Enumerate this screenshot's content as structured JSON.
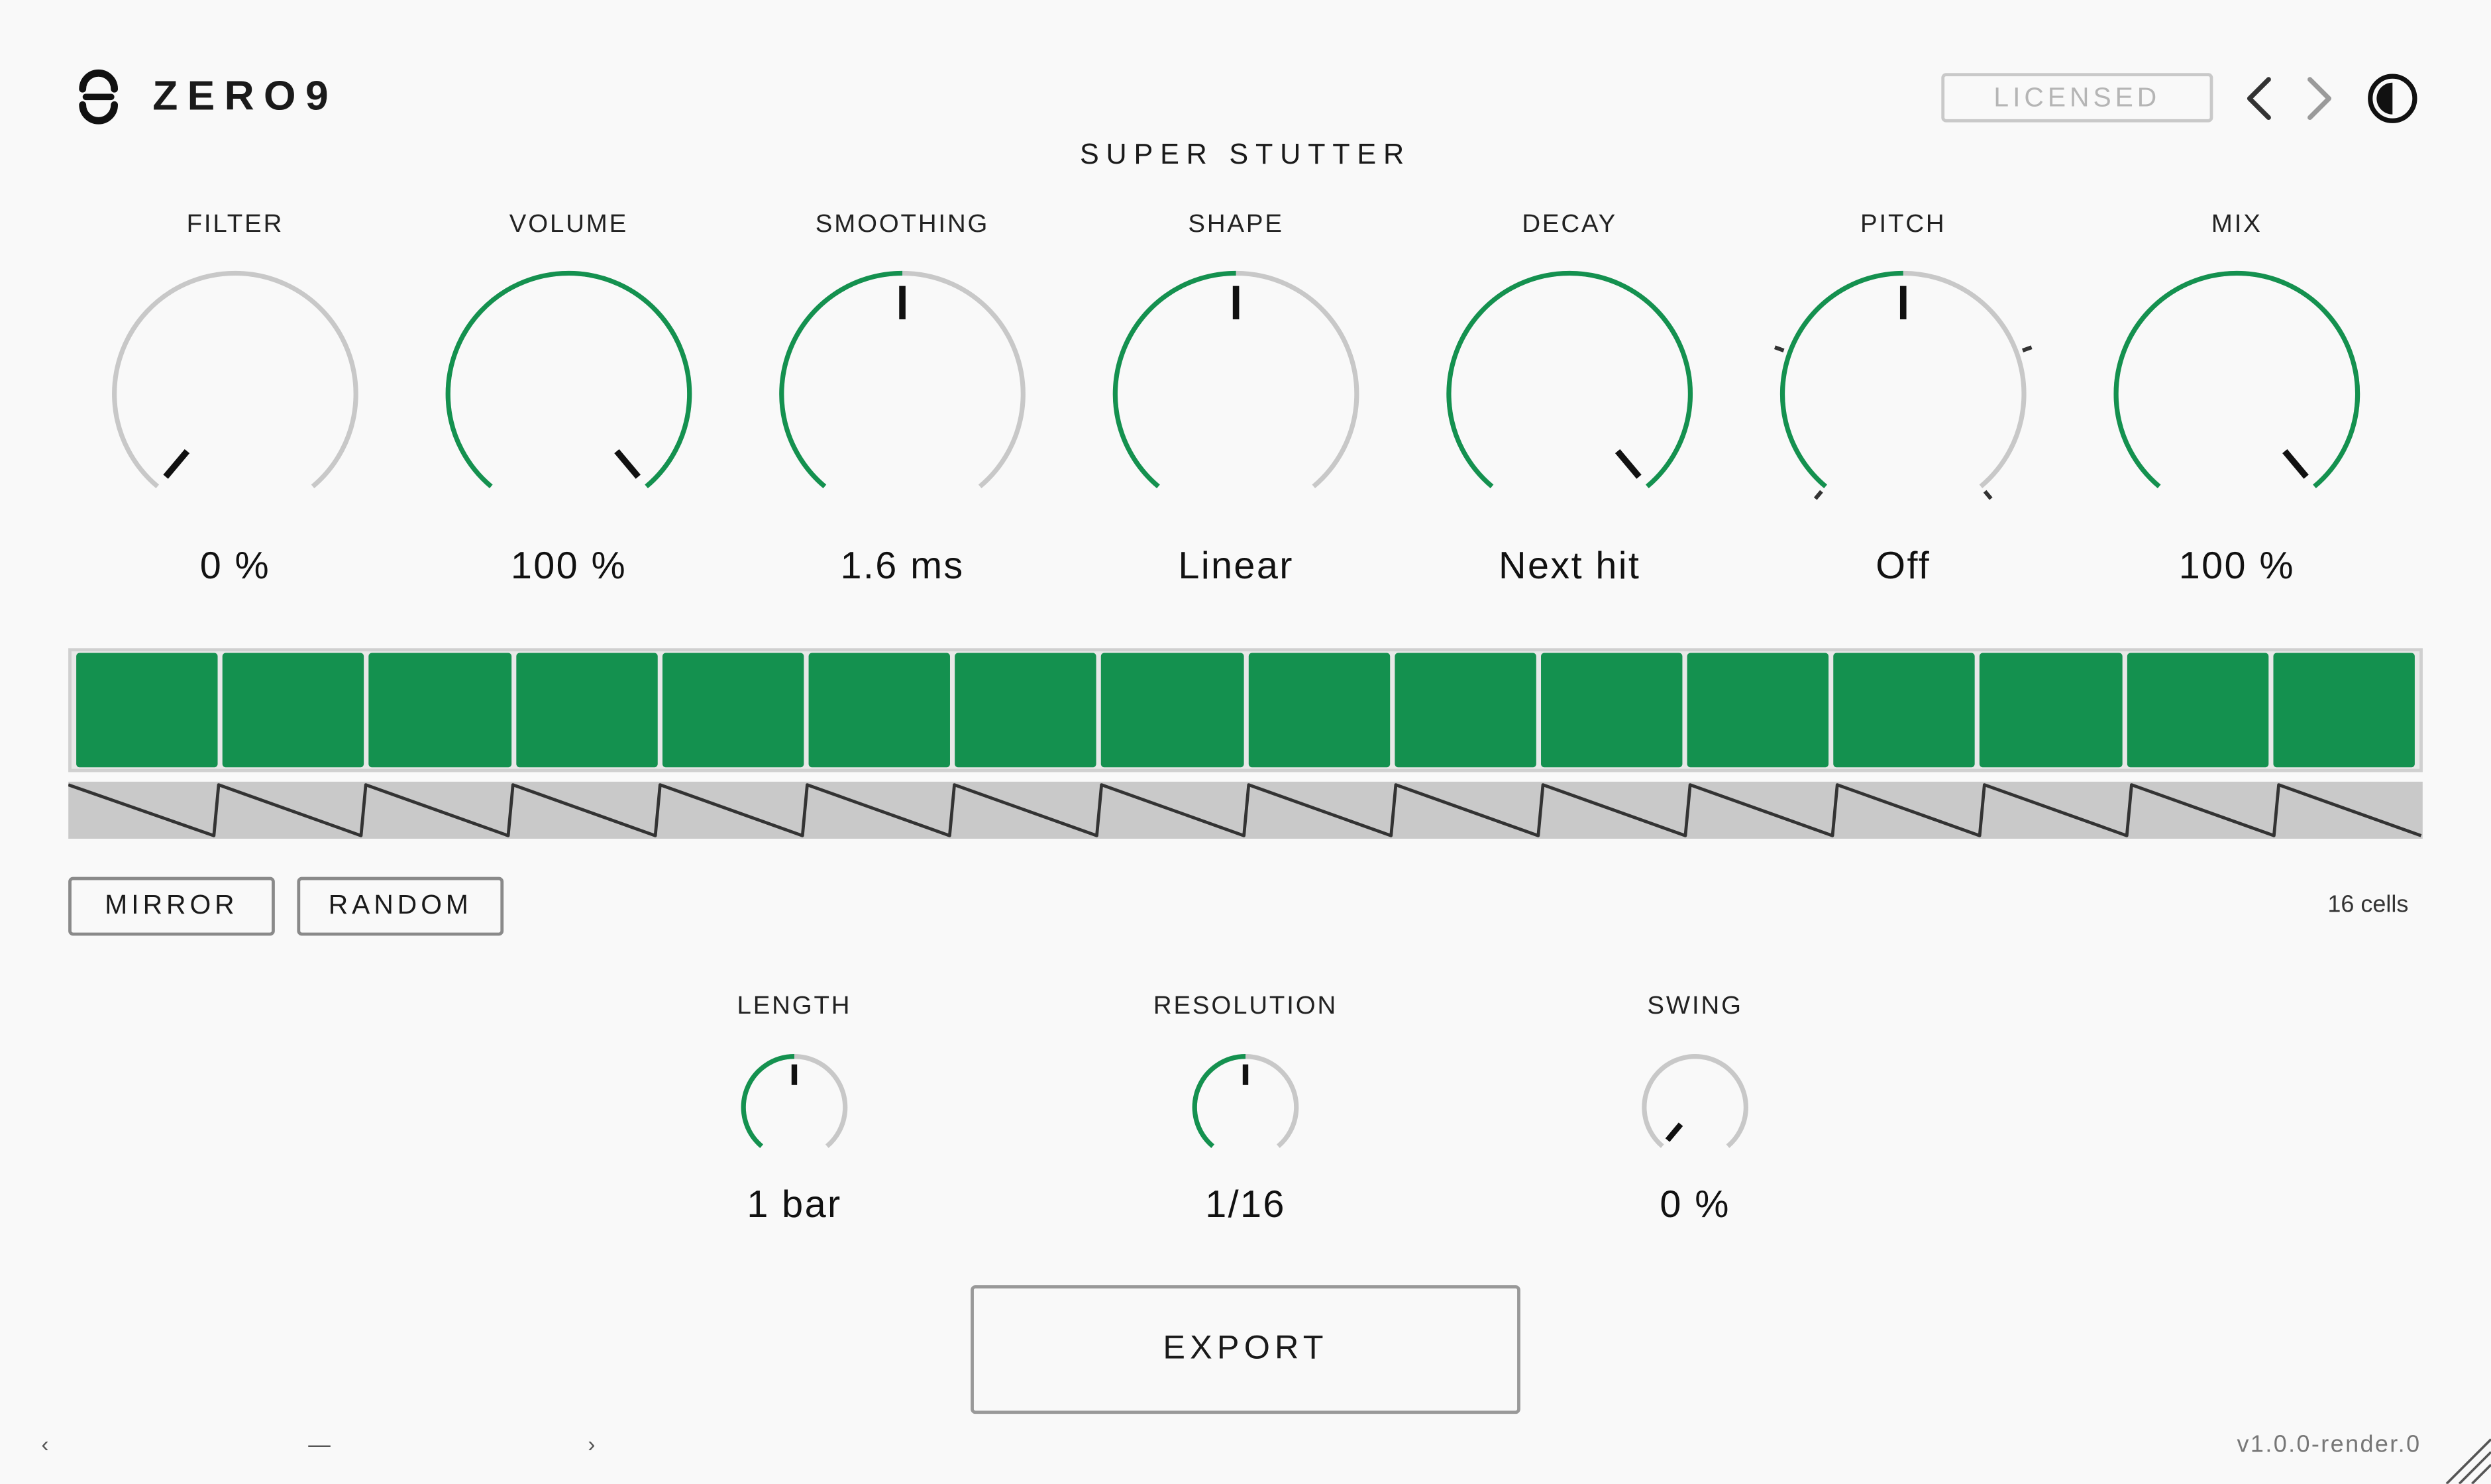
{
  "header": {
    "brand": "ZERO9",
    "product_title": "SUPER STUTTER",
    "license_label": "LICENSED",
    "icons": {
      "logo": "zero9-logo-icon",
      "prev": "chevron-left-icon",
      "next": "chevron-right-icon",
      "theme": "contrast-icon"
    }
  },
  "colors": {
    "accent": "#14914f",
    "track": "#c8c8c8",
    "indicator": "#111111",
    "background": "#f9f9f9"
  },
  "knobs": [
    {
      "label": "FILTER",
      "value_text": "0 %",
      "value": 0.0,
      "mode": "unipolar"
    },
    {
      "label": "VOLUME",
      "value_text": "100 %",
      "value": 1.0,
      "mode": "unipolar"
    },
    {
      "label": "SMOOTHING",
      "value_text": "1.6 ms",
      "value": 0.5,
      "mode": "unipolar"
    },
    {
      "label": "SHAPE",
      "value_text": "Linear",
      "value": 0.5,
      "mode": "unipolar"
    },
    {
      "label": "DECAY",
      "value_text": "Next hit",
      "value": 1.0,
      "mode": "unipolar"
    },
    {
      "label": "PITCH",
      "value_text": "Off",
      "value": 0.5,
      "mode": "stepped"
    },
    {
      "label": "MIX",
      "value_text": "100 %",
      "value": 1.0,
      "mode": "unipolar"
    }
  ],
  "sequencer": {
    "cell_count": 16,
    "cells_active": [
      true,
      true,
      true,
      true,
      true,
      true,
      true,
      true,
      true,
      true,
      true,
      true,
      true,
      true,
      true,
      true
    ],
    "envelope_shape": "sawtooth-down",
    "count_label": "16 cells",
    "mirror_label": "MIRROR",
    "random_label": "RANDOM"
  },
  "timing_knobs": [
    {
      "label": "LENGTH",
      "value_text": "1 bar",
      "value": 0.5
    },
    {
      "label": "RESOLUTION",
      "value_text": "1/16",
      "value": 0.5
    },
    {
      "label": "SWING",
      "value_text": "0 %",
      "value": 0.0
    }
  ],
  "export_label": "EXPORT",
  "footer": {
    "left_arrow": "‹",
    "separator": "—",
    "right_arrow": "›",
    "version": "v1.0.0-render.0"
  }
}
